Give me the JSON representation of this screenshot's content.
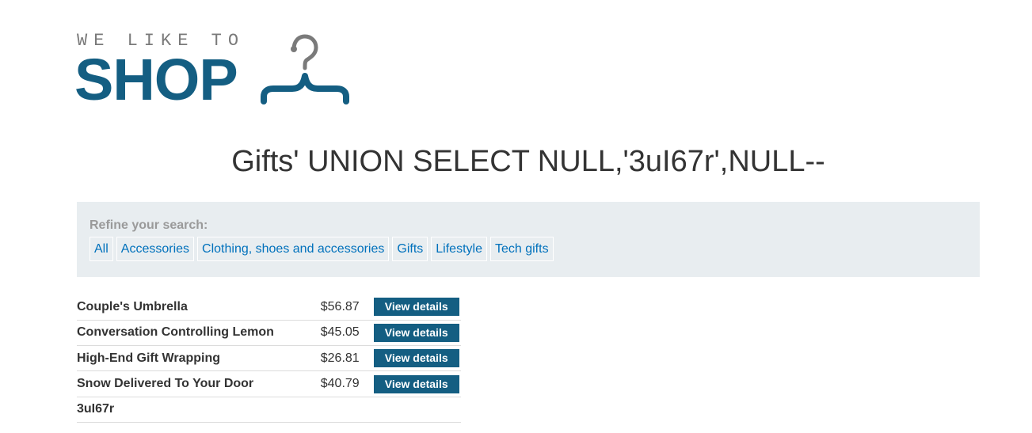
{
  "logo": {
    "tagline": "WE LIKE TO",
    "word": "SHOP",
    "icon": "hanger-icon",
    "brand_color": "#145e82"
  },
  "page_title": "Gifts' UNION SELECT NULL,'3uI67r',NULL--",
  "filter": {
    "label": "Refine your search:",
    "links": [
      "All",
      "Accessories",
      "Clothing, shoes and accessories",
      "Gifts",
      "Lifestyle",
      "Tech gifts"
    ],
    "link_color": "#0071bc",
    "panel_color": "#e8edf0"
  },
  "products": [
    {
      "name": "Couple's Umbrella",
      "price": "$56.87",
      "button": "View details"
    },
    {
      "name": "Conversation Controlling Lemon",
      "price": "$45.05",
      "button": "View details"
    },
    {
      "name": "High-End Gift Wrapping",
      "price": "$26.81",
      "button": "View details"
    },
    {
      "name": "Snow Delivered To Your Door",
      "price": "$40.79",
      "button": "View details"
    },
    {
      "name": "3uI67r",
      "price": "",
      "button": ""
    }
  ]
}
